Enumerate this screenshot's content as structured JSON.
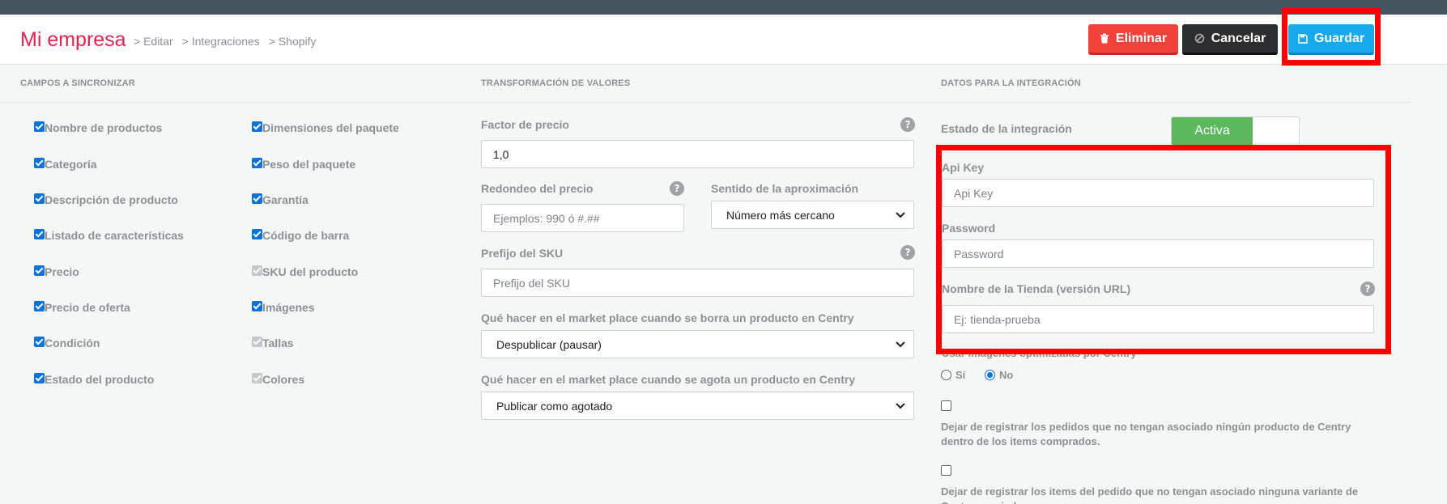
{
  "header": {
    "brand": "Mi empresa",
    "breadcrumbs": [
      "> Editar",
      "> Integraciones",
      "> Shopify"
    ],
    "buttons": {
      "delete": "Eliminar",
      "cancel": "Cancelar",
      "save": "Guardar"
    }
  },
  "sections": {
    "fields": "CAMPOS A SINCRONIZAR",
    "transform": "TRANSFORMACIÓN DE VALORES",
    "integration": "DATOS PARA LA INTEGRACIÓN"
  },
  "sync_fields_col1": [
    {
      "label": "Nombre de productos",
      "state": "checked"
    },
    {
      "label": "Categoría",
      "state": "checked"
    },
    {
      "label": "Descripción de producto",
      "state": "checked"
    },
    {
      "label": "Listado de características",
      "state": "checked"
    },
    {
      "label": "Precio",
      "state": "checked"
    },
    {
      "label": "Precio de oferta",
      "state": "checked"
    },
    {
      "label": "Condición",
      "state": "checked"
    },
    {
      "label": "Estado del producto",
      "state": "checked"
    }
  ],
  "sync_fields_col2": [
    {
      "label": "Dimensiones del paquete",
      "state": "checked"
    },
    {
      "label": "Peso del paquete",
      "state": "checked"
    },
    {
      "label": "Garantía",
      "state": "checked"
    },
    {
      "label": "Código de barra",
      "state": "checked"
    },
    {
      "label": "SKU del producto",
      "state": "disabled"
    },
    {
      "label": "Imágenes",
      "state": "checked"
    },
    {
      "label": "Tallas",
      "state": "disabled"
    },
    {
      "label": "Colores",
      "state": "disabled"
    }
  ],
  "transform": {
    "price_factor_label": "Factor de precio",
    "price_factor_value": "1,0",
    "rounding_label": "Redondeo del precio",
    "rounding_placeholder": "Ejemplos: 990 ó #.##",
    "approx_label": "Sentido de la aproximación",
    "approx_value": "Número más cercano",
    "sku_prefix_label": "Prefijo del SKU",
    "sku_prefix_placeholder": "Prefijo del SKU",
    "on_delete_label": "Qué hacer en el market place cuando se borra un producto en Centry",
    "on_delete_value": "Despublicar (pausar)",
    "on_soldout_label": "Qué hacer en el market place cuando se agota un producto en Centry",
    "on_soldout_value": "Publicar como agotado"
  },
  "integration": {
    "status_label": "Estado de la integración",
    "status_value": "Activa",
    "api_key_label": "Api Key",
    "api_key_placeholder": "Api Key",
    "password_label": "Password",
    "password_placeholder": "Password",
    "store_label": "Nombre de la Tienda (versión URL)",
    "store_placeholder": "Ej: tienda-prueba",
    "optimized_label": "Usar imágenes optimizadas por Centry",
    "radio_yes": "Sí",
    "radio_no": "No",
    "check1_text": "Dejar de registrar los pedidos que no tengan asociado ningún producto de Centry dentro de los items comprados.",
    "check2_text": "Dejar de registrar los items del pedido que no tengan asociado ninguna variante de Centry asociada."
  },
  "icons": {
    "help": "?"
  }
}
